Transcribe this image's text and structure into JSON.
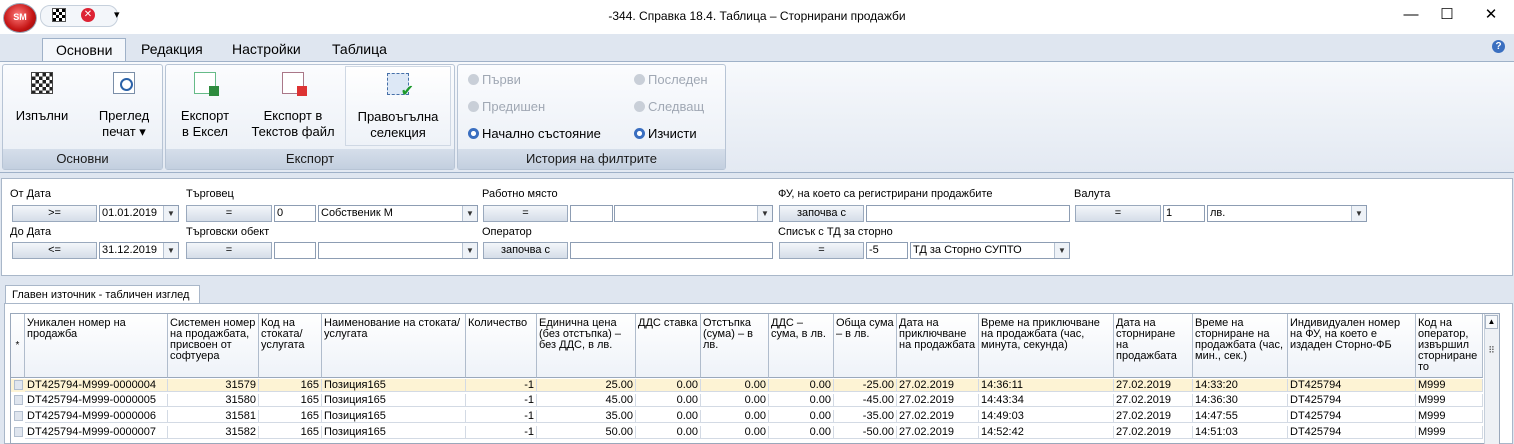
{
  "app": {
    "logo_text": "SM"
  },
  "window": {
    "title": "-344. Справка 18.4. Таблица – Сторнирани продажби",
    "minimize": "—",
    "maximize": "☐",
    "close": "✕",
    "qat_more": "▾"
  },
  "tabs": [
    "Основни",
    "Редакция",
    "Настройки",
    "Таблица"
  ],
  "ribbon": {
    "groups": {
      "main": "Основни",
      "export": "Експорт",
      "history": "История на филтрите"
    },
    "run": "Изпълни",
    "preview_line1": "Преглед",
    "preview_line2": "печат ▾",
    "export_excel_1": "Експорт",
    "export_excel_2": "в Ексел",
    "export_text_1": "Експорт в",
    "export_text_2": "Текстов файл",
    "rect_sel_1": "Правоъгълна",
    "rect_sel_2": "селекция",
    "first": "Първи",
    "prev": "Предишен",
    "initial": "Начално състояние",
    "last": "Последен",
    "next": "Следващ",
    "clear": "Изчисти"
  },
  "filters": {
    "from_date": {
      "label": "От Дата",
      "op": ">=",
      "value": "01.01.2019"
    },
    "to_date": {
      "label": "До Дата",
      "op": "<=",
      "value": "31.12.2019"
    },
    "merchant": {
      "label": "Търговец",
      "op": "=",
      "code": "0",
      "name": "Собственик М"
    },
    "site": {
      "label": "Търговски обект",
      "op": "=",
      "code": "",
      "name": ""
    },
    "workplace": {
      "label": "Работно място",
      "op": "=",
      "code": "",
      "name": ""
    },
    "operator": {
      "label": "Оператор",
      "op": "започва с",
      "value": ""
    },
    "fu": {
      "label": "ФУ, на което са регистрирани продажбите",
      "op": "започва с",
      "value": ""
    },
    "td_list": {
      "label": "Списък с ТД за сторно",
      "op": "=",
      "code": "-5",
      "name": "ТД за Сторно СУПТО"
    },
    "currency": {
      "label": "Валута",
      "op": "=",
      "code": "1",
      "name": "лв."
    }
  },
  "grid": {
    "tab_label": "Главен източник - табличен изглед",
    "new_row_marker": "*",
    "headers": [
      "Уникален номер на продажба",
      "Системен номер на продажбата, присвоен от софтуера",
      "Код на стоката/услугата",
      "Наименование на стоката/услугата",
      "Количество",
      "Единична цена (без отстъпка) – без ДДС, в лв.",
      "ДДС ставка",
      "Отстъпка (сума) – в лв.",
      "ДДС – сума, в лв.",
      "Обща сума – в лв.",
      "Дата на приключване на продажбата",
      "Време на приключване на продажбата (час, минута, секунда)",
      "Дата на сторниране на продажбата",
      "Време на сторниране на продажбата (час, мин., сек.)",
      "Индивидуален номер на ФУ, на което е издаден Сторно-ФБ",
      "Код на оператор, извършил сторниране то"
    ],
    "rows": [
      [
        "DT425794-M999-0000004",
        "31579",
        "165",
        "Позиция165",
        "-1",
        "25.00",
        "0.00",
        "0.00",
        "0.00",
        "-25.00",
        "27.02.2019",
        "14:36:11",
        "27.02.2019",
        "14:33:20",
        "DT425794",
        "M999"
      ],
      [
        "DT425794-M999-0000005",
        "31580",
        "165",
        "Позиция165",
        "-1",
        "45.00",
        "0.00",
        "0.00",
        "0.00",
        "-45.00",
        "27.02.2019",
        "14:43:34",
        "27.02.2019",
        "14:36:30",
        "DT425794",
        "M999"
      ],
      [
        "DT425794-M999-0000006",
        "31581",
        "165",
        "Позиция165",
        "-1",
        "35.00",
        "0.00",
        "0.00",
        "0.00",
        "-35.00",
        "27.02.2019",
        "14:49:03",
        "27.02.2019",
        "14:47:55",
        "DT425794",
        "M999"
      ],
      [
        "DT425794-M999-0000007",
        "31582",
        "165",
        "Позиция165",
        "-1",
        "50.00",
        "0.00",
        "0.00",
        "0.00",
        "-50.00",
        "27.02.2019",
        "14:52:42",
        "27.02.2019",
        "14:51:03",
        "DT425794",
        "M999"
      ]
    ]
  },
  "colors": {
    "selected_row": "#fdf3d4",
    "row": "#ffffff",
    "ribbon_caption": "#c9d4e3",
    "orb": "#c41414"
  },
  "icons": [
    "app-orb-icon",
    "checkered-flag-icon",
    "cancel-icon",
    "print-preview-icon",
    "excel-export-icon",
    "text-export-icon",
    "rectangular-selection-icon",
    "help-icon"
  ]
}
